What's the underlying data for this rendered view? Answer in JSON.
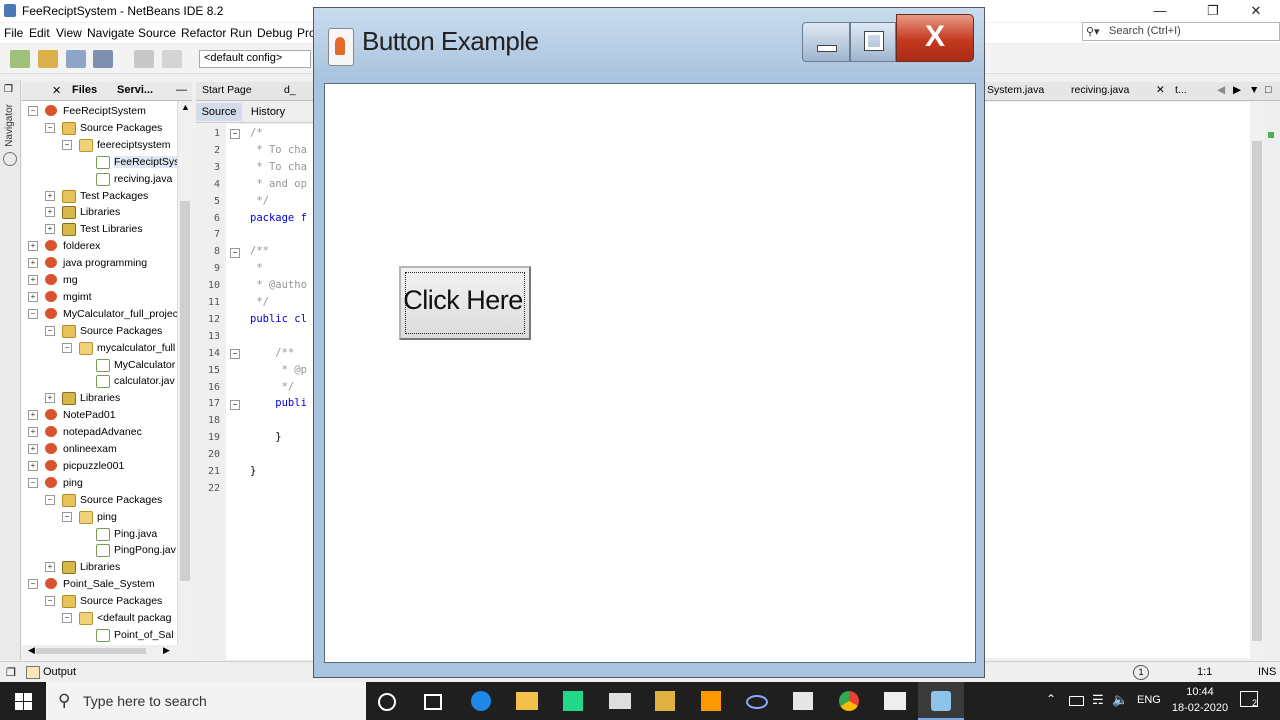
{
  "ide": {
    "title": "FeeReciptSystem - NetBeans IDE 8.2",
    "menus": [
      "File",
      "Edit",
      "View",
      "Navigate",
      "Source",
      "Refactor",
      "Run",
      "Debug",
      "Pro"
    ],
    "search_placeholder": "Search (Ctrl+I)",
    "config": "<default config>",
    "navigator_label": "Navigator",
    "panel_tabs": [
      "Files",
      "Servi..."
    ],
    "editor_tabs_left": [
      "Start Page",
      "d_"
    ],
    "editor_tabs_right": [
      "System.java",
      "reciving.java",
      "t..."
    ],
    "source_label": "Source",
    "history_label": "History",
    "output_label": "Output",
    "status_position": "1:1",
    "status_mode": "INS",
    "status_notify": "1"
  },
  "tree": [
    {
      "label": "FeeReciptSystem",
      "depth": 0,
      "icon": "project",
      "exp": "-"
    },
    {
      "label": "Source Packages",
      "depth": 1,
      "icon": "folder",
      "exp": "-"
    },
    {
      "label": "feereciptsystem",
      "depth": 2,
      "icon": "package",
      "exp": "-"
    },
    {
      "label": "FeeReciptSys",
      "depth": 3,
      "icon": "java",
      "exp": ""
    },
    {
      "label": "reciving.java",
      "depth": 3,
      "icon": "java",
      "exp": ""
    },
    {
      "label": "Test Packages",
      "depth": 1,
      "icon": "folder",
      "exp": "+"
    },
    {
      "label": "Libraries",
      "depth": 1,
      "icon": "library",
      "exp": "+"
    },
    {
      "label": "Test Libraries",
      "depth": 1,
      "icon": "library",
      "exp": "+"
    },
    {
      "label": "folderex",
      "depth": 0,
      "icon": "project",
      "exp": "+"
    },
    {
      "label": "java programming",
      "depth": 0,
      "icon": "project",
      "exp": "+"
    },
    {
      "label": "mg",
      "depth": 0,
      "icon": "project",
      "exp": "+"
    },
    {
      "label": "mgimt",
      "depth": 0,
      "icon": "project",
      "exp": "+"
    },
    {
      "label": "MyCalculator_full_projec",
      "depth": 0,
      "icon": "project",
      "exp": "-"
    },
    {
      "label": "Source Packages",
      "depth": 1,
      "icon": "folder",
      "exp": "-"
    },
    {
      "label": "mycalculator_full",
      "depth": 2,
      "icon": "package",
      "exp": "-"
    },
    {
      "label": "MyCalculator",
      "depth": 3,
      "icon": "java",
      "exp": ""
    },
    {
      "label": "calculator.jav",
      "depth": 3,
      "icon": "java",
      "exp": ""
    },
    {
      "label": "Libraries",
      "depth": 1,
      "icon": "library",
      "exp": "+"
    },
    {
      "label": "NotePad01",
      "depth": 0,
      "icon": "project",
      "exp": "+"
    },
    {
      "label": "notepadAdvanec",
      "depth": 0,
      "icon": "project",
      "exp": "+"
    },
    {
      "label": "onlineexam",
      "depth": 0,
      "icon": "project",
      "exp": "+"
    },
    {
      "label": "picpuzzle001",
      "depth": 0,
      "icon": "project",
      "exp": "+"
    },
    {
      "label": "ping",
      "depth": 0,
      "icon": "project",
      "exp": "-"
    },
    {
      "label": "Source Packages",
      "depth": 1,
      "icon": "folder",
      "exp": "-"
    },
    {
      "label": "ping",
      "depth": 2,
      "icon": "package",
      "exp": "-"
    },
    {
      "label": "Ping.java",
      "depth": 3,
      "icon": "java",
      "exp": ""
    },
    {
      "label": "PingPong.jav",
      "depth": 3,
      "icon": "java",
      "exp": ""
    },
    {
      "label": "Libraries",
      "depth": 1,
      "icon": "library",
      "exp": "+"
    },
    {
      "label": "Point_Sale_System",
      "depth": 0,
      "icon": "project",
      "exp": "-"
    },
    {
      "label": "Source Packages",
      "depth": 1,
      "icon": "folder",
      "exp": "-"
    },
    {
      "label": "<default packag",
      "depth": 2,
      "icon": "package",
      "exp": "-"
    },
    {
      "label": "Point_of_Sal",
      "depth": 3,
      "icon": "java",
      "exp": ""
    }
  ],
  "code_lines": [
    {
      "n": "1",
      "text": "/*",
      "cls": "cmt"
    },
    {
      "n": "2",
      "text": " * To cha",
      "cls": "cmt"
    },
    {
      "n": "3",
      "text": " * To cha",
      "cls": "cmt"
    },
    {
      "n": "4",
      "text": " * and op",
      "cls": "cmt"
    },
    {
      "n": "5",
      "text": " */",
      "cls": "cmt"
    },
    {
      "n": "6",
      "text": "package f",
      "cls": "kw"
    },
    {
      "n": "7",
      "text": "",
      "cls": ""
    },
    {
      "n": "8",
      "text": "/**",
      "cls": "cmt"
    },
    {
      "n": "9",
      "text": " *",
      "cls": "cmt"
    },
    {
      "n": "10",
      "text": " * @autho",
      "cls": "cmt"
    },
    {
      "n": "11",
      "text": " */",
      "cls": "cmt"
    },
    {
      "n": "12",
      "text": "public cl",
      "cls": "kw"
    },
    {
      "n": "13",
      "text": "",
      "cls": ""
    },
    {
      "n": "14",
      "text": "    /**",
      "cls": "cmt"
    },
    {
      "n": "15",
      "text": "     * @p",
      "cls": "cmt"
    },
    {
      "n": "16",
      "text": "     */",
      "cls": "cmt"
    },
    {
      "n": "17",
      "text": "    publi",
      "cls": "kw"
    },
    {
      "n": "18",
      "text": "",
      "cls": ""
    },
    {
      "n": "19",
      "text": "    }",
      "cls": ""
    },
    {
      "n": "20",
      "text": "",
      "cls": ""
    },
    {
      "n": "21",
      "text": "}",
      "cls": ""
    },
    {
      "n": "22",
      "text": "",
      "cls": ""
    }
  ],
  "window": {
    "title": "Button Example",
    "close_glyph": "X",
    "button_label": "Click Here"
  },
  "taskbar": {
    "search_placeholder": "Type here to search",
    "language": "ENG",
    "time": "10:44",
    "date": "18-02-2020",
    "notification_count": "2",
    "pinned_icons": [
      "task-view-icon",
      "edge-icon",
      "file-explorer-icon",
      "pycharm-icon",
      "mail-icon",
      "tool-icon",
      "sublime-icon",
      "link-icon",
      "store-icon",
      "chrome-icon",
      "photos-icon",
      "netbeans-icon"
    ]
  }
}
